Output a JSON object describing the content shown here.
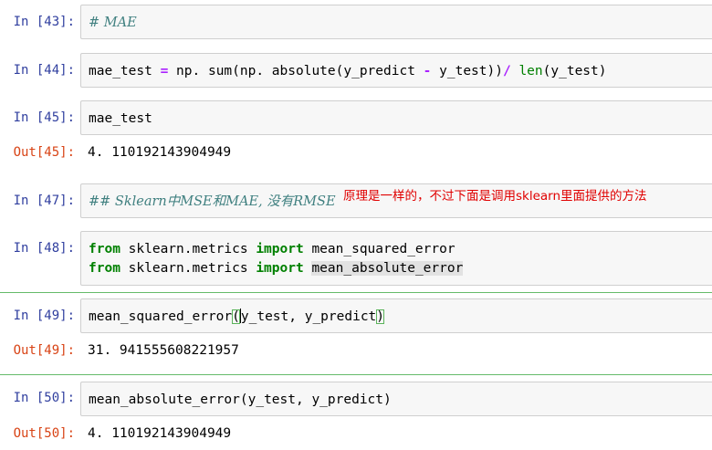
{
  "cells": [
    {
      "prompt": "In [43]:",
      "code": [
        "# MAE"
      ]
    },
    {
      "prompt": "In [44]:",
      "code": [
        "mae_test = np. sum(np. absolute(y_predict - y_test))/ len(y_test)"
      ]
    },
    {
      "prompt": "In [45]:",
      "code": [
        "mae_test"
      ],
      "out_prompt": "Out[45]:",
      "output": "4. 110192143904949"
    },
    {
      "prompt": "In [47]:",
      "code": [
        "## Sklearn中MSE和MAE, 没有RMSE"
      ],
      "annotation": "原理是一样的，不过下面是调用sklearn里面提供的方法"
    },
    {
      "prompt": "In [48]:",
      "code": [
        "from sklearn.metrics import mean_squared_error",
        "from sklearn.metrics import mean_absolute_error"
      ]
    },
    {
      "prompt": "In [49]:",
      "code": [
        "mean_squared_error(y_test, y_predict)"
      ],
      "out_prompt": "Out[49]:",
      "output": "31. 941555608221957"
    },
    {
      "prompt": "In [50]:",
      "code": [
        "mean_absolute_error(y_test, y_predict)"
      ],
      "out_prompt": "Out[50]:",
      "output": "4. 110192143904949"
    }
  ],
  "tokens": {
    "c44": {
      "a": "mae_test ",
      "eq": "=",
      "b": " np. sum(np. absolute(y_predict ",
      "minus": "-",
      "c": " y_test))",
      "div": "/",
      "d": " ",
      "len": "len",
      "e": "(y_test)"
    },
    "c47": {
      "text": "## Sklearn中MSE和MAE, 没有RMSE"
    },
    "c48": {
      "l1_from": "from",
      "l1_mod": " sklearn.metrics ",
      "l1_import": "import",
      "l1_name": " mean_squared_error",
      "l2_from": "from",
      "l2_mod": " sklearn.metrics ",
      "l2_import": "import",
      "l2_name": "mean_absolute_error"
    },
    "c49": {
      "fn": "mean_squared_error",
      "open": "(",
      "args": "y_test, y_predict",
      "close": ")"
    },
    "c50": {
      "fn": "mean_absolute_error",
      "open": "(",
      "args": "y_test, y_predict",
      "close": ")"
    }
  },
  "colors": {
    "in_prompt": "#303f9f",
    "out_prompt": "#d84315",
    "comment": "#408080",
    "keyword": "#008000",
    "operator": "#aa22ff",
    "annotation": "#e00000",
    "selected_border": "#66bb6a"
  }
}
